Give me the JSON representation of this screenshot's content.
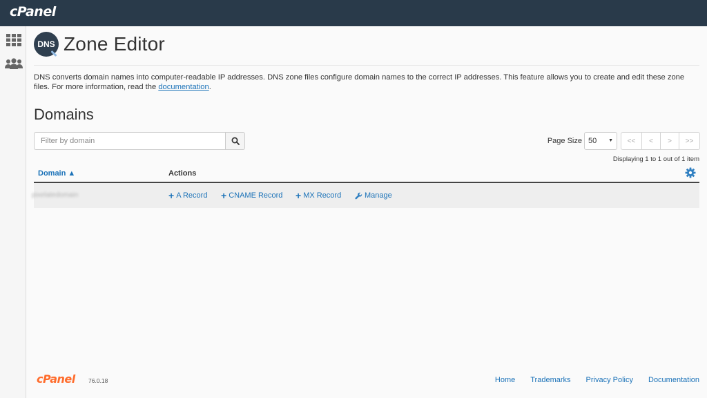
{
  "header": {
    "logo": "cPanel"
  },
  "sidebar": {
    "items": [
      {
        "icon": "grid-icon"
      },
      {
        "icon": "users-icon"
      }
    ]
  },
  "page": {
    "badge": "DNS",
    "title": "Zone Editor",
    "description_text": "DNS converts domain names into computer-readable IP addresses. DNS zone files configure domain names to the correct IP addresses. This feature allows you to create and edit these zone files. For more information, read the ",
    "description_link": "documentation",
    "description_end": "."
  },
  "domains": {
    "title": "Domains",
    "search_placeholder": "Filter by domain",
    "page_size_label": "Page Size",
    "page_size_value": "50",
    "pager": {
      "first": "<<",
      "prev": "<",
      "next": ">",
      "last": ">>"
    },
    "displaying": "Displaying 1 to 1 out of 1 item",
    "columns": {
      "domain": "Domain ▲",
      "actions": "Actions"
    },
    "rows": [
      {
        "domain": "pixelatedomain",
        "actions": {
          "a_record": "A Record",
          "cname_record": "CNAME Record",
          "mx_record": "MX Record",
          "manage": "Manage"
        }
      }
    ]
  },
  "footer": {
    "logo": "cPanel",
    "version": "76.0.18",
    "links": [
      "Home",
      "Trademarks",
      "Privacy Policy",
      "Documentation"
    ]
  },
  "colors": {
    "topbar": "#293a4a",
    "link": "#1b72b8",
    "footer_logo": "#ff6c2c"
  }
}
